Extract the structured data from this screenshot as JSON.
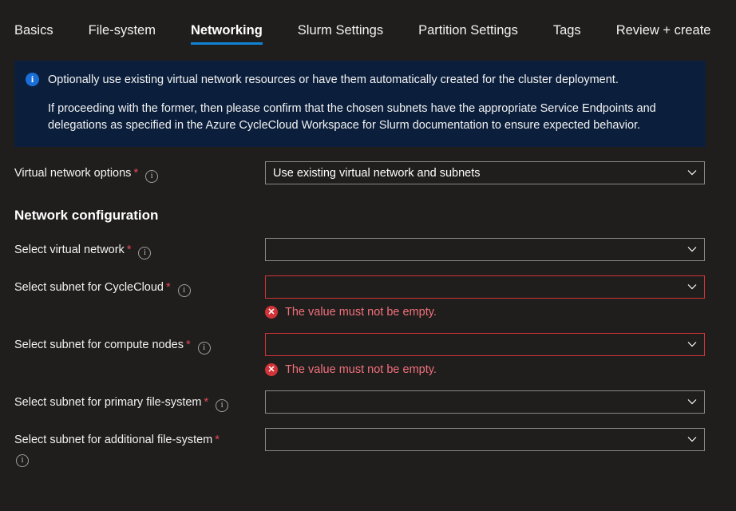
{
  "tabs": [
    {
      "label": "Basics",
      "active": false
    },
    {
      "label": "File-system",
      "active": false
    },
    {
      "label": "Networking",
      "active": true
    },
    {
      "label": "Slurm Settings",
      "active": false
    },
    {
      "label": "Partition Settings",
      "active": false
    },
    {
      "label": "Tags",
      "active": false
    },
    {
      "label": "Review + create",
      "active": false
    }
  ],
  "banner": {
    "icon": "info-icon",
    "icon_glyph": "i",
    "paragraph1": "Optionally use existing virtual network resources or have them automatically created for the cluster deployment.",
    "paragraph2": "If proceeding with the former, then please confirm that the chosen subnets have the appropriate Service Endpoints and delegations as specified in the Azure CycleCloud Workspace for Slurm documentation to ensure expected behavior.",
    "background": "#0b1f3d"
  },
  "vnet_options": {
    "label": "Virtual network options",
    "required_marker": "*",
    "info_glyph": "i",
    "value": "Use existing virtual network and subnets"
  },
  "section": {
    "title": "Network configuration"
  },
  "error_text": "The value must not be empty.",
  "error_glyph": "✕",
  "fields": [
    {
      "label": "Select virtual network",
      "required_marker": "*",
      "info_glyph": "i",
      "value": "",
      "error": false,
      "label_wraps": false
    },
    {
      "label": "Select subnet for CycleCloud",
      "required_marker": "*",
      "info_glyph": "i",
      "value": "",
      "error": true,
      "label_wraps": false
    },
    {
      "label": "Select subnet for compute nodes",
      "required_marker": "*",
      "info_glyph": "i",
      "value": "",
      "error": true,
      "label_wraps": false
    },
    {
      "label": "Select subnet for primary file-system",
      "required_marker": "*",
      "info_glyph": "i",
      "value": "",
      "error": false,
      "label_wraps": false
    },
    {
      "label": "Select subnet for additional file-system",
      "required_marker": "*",
      "info_glyph": "i",
      "value": "",
      "error": false,
      "label_wraps": true
    }
  ],
  "colors": {
    "accent": "#0f83d6",
    "error": "#d13438",
    "error_text": "#f1707b",
    "required": "#e74856",
    "page_bg": "#1f1e1d"
  }
}
